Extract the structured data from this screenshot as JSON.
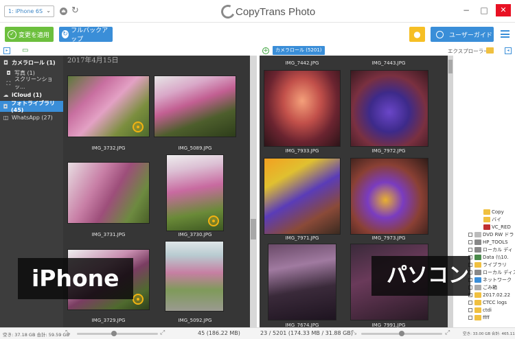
{
  "titlebar": {
    "device_select": "1: iPhone 6S",
    "app_title": "CopyTrans Photo",
    "minimize": "−",
    "maximize": "□",
    "close": "✕"
  },
  "toolbar": {
    "apply_label": "変更を適用",
    "backup_label": "フルバックアップ",
    "guide_label": "ユーザーガイド"
  },
  "subbar": {
    "album_badge": "カメラロール (5201)",
    "explorer_label": "エクスプローラー"
  },
  "sidebar": {
    "items": [
      {
        "label": "カメラロール (1)",
        "icon": "camera-icon"
      },
      {
        "label": "写真 (1)",
        "icon": "camera-icon"
      },
      {
        "label": "スクリーンショッ...",
        "icon": "screenshot-icon"
      },
      {
        "label": "iCloud (1)",
        "icon": "cloud-icon"
      },
      {
        "label": "フォトライブラリ (45)",
        "icon": "photo-library-icon"
      },
      {
        "label": "WhatsApp (27)",
        "icon": "whatsapp-icon"
      }
    ]
  },
  "left_pane": {
    "date_header": "2017年4月15日",
    "photos": [
      {
        "name": "IMG_3732.JPG"
      },
      {
        "name": "IMG_5089.JPG"
      },
      {
        "name": "IMG_3731.JPG"
      },
      {
        "name": "IMG_3730.JPG"
      },
      {
        "name": "IMG_3729.JPG"
      },
      {
        "name": "IMG_5092.JPG"
      }
    ]
  },
  "right_pane": {
    "top_labels": [
      "IMG_7442.JPG",
      "IMG_7443.JPG"
    ],
    "photos": [
      {
        "name": "IMG_7933.JPG"
      },
      {
        "name": "IMG_7972.JPG"
      },
      {
        "name": "IMG_7971.JPG"
      },
      {
        "name": "IMG_7973.JPG"
      },
      {
        "name": "IMG_7674.JPG"
      },
      {
        "name": "IMG_7991.JPG"
      }
    ]
  },
  "explorer": {
    "items": [
      "Copy",
      "バイ",
      "VC_RED",
      "DVD RW ドラ",
      "HP_TOOLS",
      "ローカル ディ",
      "Data (\\\\10.",
      "ライブラリ",
      "ローカル ディスク",
      "ネットワーク",
      "ごみ箱",
      "2017.02.22",
      "CTCC logs",
      "ctdi",
      "ffff"
    ]
  },
  "overlays": {
    "left": "iPhone",
    "right": "パソコン"
  },
  "statusbar": {
    "left_small": "空き: 37.18 GB 合計: 59.59 GB",
    "left_count": "45 (186.22 MB)",
    "right_count": "23 / 5201 (174.33 MB / 31.88 GB)",
    "right_small": "空き: 33.00 GB 合計: 465.11 GB"
  },
  "colors": {
    "accent_blue": "#3a8ed8",
    "apply_green": "#6cbf3d",
    "bulb_yellow": "#f6bf25",
    "pane_bg": "#363636",
    "sidebar_bg": "#3d3d3d"
  }
}
